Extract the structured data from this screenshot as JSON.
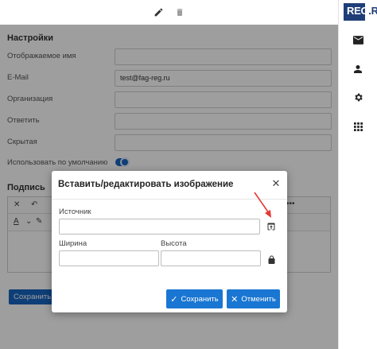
{
  "toolbar": {
    "edit_icon": "pencil-icon",
    "delete_icon": "trash-icon"
  },
  "brand": {
    "logo_text_reg": "REG",
    "logo_text_ru": ".RU",
    "color": "#1f3e78"
  },
  "rail": {
    "items": [
      "mail-icon",
      "person-icon",
      "gear-icon",
      "apps-grid-icon"
    ]
  },
  "settings": {
    "title": "Настройки",
    "fields": [
      {
        "label": "Отображаемое имя",
        "value": ""
      },
      {
        "label": "E-Mail",
        "value": "test@fag-reg.ru"
      },
      {
        "label": "Организация",
        "value": ""
      },
      {
        "label": "Ответить",
        "value": ""
      },
      {
        "label": "Скрытая",
        "value": ""
      }
    ],
    "default_label": "Использовать по умолчанию",
    "default_on": true
  },
  "signature": {
    "title": "Подпись",
    "save_label": "Сохранить"
  },
  "modal": {
    "title": "Вставить/редактировать изображение",
    "source_label": "Источник",
    "source_value": "",
    "width_label": "Ширина",
    "width_value": "",
    "height_label": "Высота",
    "height_value": "",
    "save_label": "Сохранить",
    "cancel_label": "Отменить"
  },
  "colors": {
    "accent": "#1976d2",
    "annotation_arrow": "#e53935"
  }
}
